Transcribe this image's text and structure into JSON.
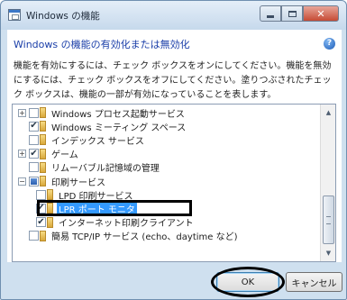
{
  "window": {
    "title": "Windows の機能",
    "heading": "Windows の機能の有効化または無効化",
    "description": "機能を有効にするには、チェック ボックスをオンにしてください。機能を無効にするには、チェック ボックスをオフにしてください。塗りつぶされたチェック ボックスは、機能の一部が有効になっていることを表します。"
  },
  "icons": {
    "app": "windows-features-icon",
    "help": "help-icon",
    "folder": "folder-icon"
  },
  "controls": {
    "help_glyph": "?"
  },
  "tree": {
    "items": [
      {
        "label": "Windows プロセス起動サービス",
        "level": 0,
        "expander": "+",
        "state": "unchecked"
      },
      {
        "label": "Windows ミーティング スペース",
        "level": 0,
        "expander": "",
        "state": "checked"
      },
      {
        "label": "インデックス サービス",
        "level": 0,
        "expander": "",
        "state": "unchecked"
      },
      {
        "label": "ゲーム",
        "level": 0,
        "expander": "+",
        "state": "checked"
      },
      {
        "label": "リムーバブル記憶域の管理",
        "level": 0,
        "expander": "",
        "state": "unchecked"
      },
      {
        "label": "印刷サービス",
        "level": 0,
        "expander": "−",
        "state": "partial"
      },
      {
        "label": "LPD 印刷サービス",
        "level": 1,
        "expander": "",
        "state": "unchecked"
      },
      {
        "label": "LPR ポート モニタ",
        "level": 1,
        "expander": "",
        "state": "checked",
        "selected": true
      },
      {
        "label": "インターネット印刷クライアント",
        "level": 1,
        "expander": "",
        "state": "checked"
      },
      {
        "label": "簡易 TCP/IP サービス (echo、daytime など)",
        "level": 0,
        "expander": "",
        "state": "unchecked"
      }
    ]
  },
  "buttons": {
    "ok": "OK",
    "cancel": "キャンセル"
  },
  "colors": {
    "heading": "#1a3ea8",
    "selection": "#3399ff",
    "annotation": "#000000"
  }
}
